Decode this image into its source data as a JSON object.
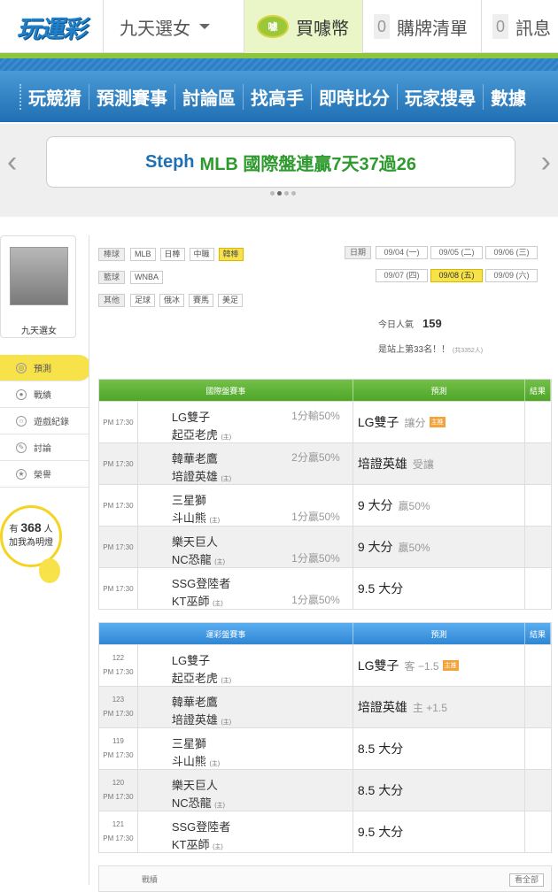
{
  "header": {
    "logo": "玩運彩",
    "user": "九天選女",
    "buy_coin": "買噱幣",
    "coin_icon_text": "噱",
    "cart": {
      "count": "0",
      "label": "購牌清單"
    },
    "messages": {
      "count": "0",
      "label": "訊息"
    }
  },
  "nav": [
    "玩競猜",
    "預測賽事",
    "討論區",
    "找高手",
    "即時比分",
    "玩家搜尋",
    "數據"
  ],
  "banner": {
    "prefix": "Steph",
    "text": "MLB 國際盤連贏7天37過26"
  },
  "sidebar": {
    "name": "九天選女",
    "menu": [
      "預測",
      "戰績",
      "遊戲紀錄",
      "討論",
      "榮譽"
    ],
    "fans_prefix": "有",
    "fans_count": "368",
    "fans_suffix": "人",
    "fans_note": "加我為明燈"
  },
  "filters": {
    "baseball_label": "棒球",
    "baseball": [
      "MLB",
      "日棒",
      "中職",
      "韓棒"
    ],
    "basketball_label": "籃球",
    "basketball": [
      "WNBA"
    ],
    "other_label": "其他",
    "other": [
      "足球",
      "俄冰",
      "賽馬",
      "美足"
    ]
  },
  "dates": {
    "label": "日期",
    "row1": [
      "09/04 (一)",
      "09/05 (二)",
      "09/06 (三)"
    ],
    "row2": [
      "09/07 (四)",
      "09/08 (五)",
      "09/09 (六)"
    ]
  },
  "stats": {
    "pop_label": "今日人氣",
    "pop_value": "159",
    "rank": "是站上第33名！！",
    "rank_small": "(共3352人)"
  },
  "intl": {
    "headers": [
      "國際盤賽事",
      "預測",
      "結果"
    ],
    "rows": [
      {
        "time": "PM 17:30",
        "t1": "LG雙子",
        "t2": "起亞老虎",
        "o1": "1分輸50%",
        "o2": "",
        "pick": "LG雙子",
        "sub": "讓分",
        "tag": "主推"
      },
      {
        "time": "PM 17:30",
        "t1": "韓華老鷹",
        "t2": "培證英雄",
        "o1": "2分贏50%",
        "o2": "",
        "pick": "培證英雄",
        "sub": "受讓",
        "tag": ""
      },
      {
        "time": "PM 17:30",
        "t1": "三星獅",
        "t2": "斗山熊",
        "o1": "",
        "o2": "1分贏50%",
        "pick": "9 大分",
        "sub": "贏50%",
        "tag": ""
      },
      {
        "time": "PM 17:30",
        "t1": "樂天巨人",
        "t2": "NC恐龍",
        "o1": "",
        "o2": "1分贏50%",
        "pick": "9 大分",
        "sub": "贏50%",
        "tag": ""
      },
      {
        "time": "PM 17:30",
        "t1": "SSG登陸者",
        "t2": "KT巫師",
        "o1": "",
        "o2": "1分贏50%",
        "pick": "9.5 大分",
        "sub": "",
        "tag": ""
      }
    ]
  },
  "lottery": {
    "headers": [
      "運彩盤賽事",
      "預測",
      "結果"
    ],
    "rows": [
      {
        "no": "122",
        "time": "PM 17:30",
        "t1": "LG雙子",
        "t2": "起亞老虎",
        "pick": "LG雙子",
        "sub": "客 −1.5",
        "tag": "主推"
      },
      {
        "no": "123",
        "time": "PM 17:30",
        "t1": "韓華老鷹",
        "t2": "培證英雄",
        "pick": "培證英雄",
        "sub": "主 +1.5",
        "tag": ""
      },
      {
        "no": "119",
        "time": "PM 17:30",
        "t1": "三星獅",
        "t2": "斗山熊",
        "pick": "8.5 大分",
        "sub": "",
        "tag": ""
      },
      {
        "no": "120",
        "time": "PM 17:30",
        "t1": "樂天巨人",
        "t2": "NC恐龍",
        "pick": "8.5 大分",
        "sub": "",
        "tag": ""
      },
      {
        "no": "121",
        "time": "PM 17:30",
        "t1": "SSG登陸者",
        "t2": "KT巫師",
        "pick": "9.5 大分",
        "sub": "",
        "tag": ""
      }
    ]
  },
  "home_marker": "(主)",
  "bottom": {
    "label": "戰績",
    "button": "看全部"
  }
}
